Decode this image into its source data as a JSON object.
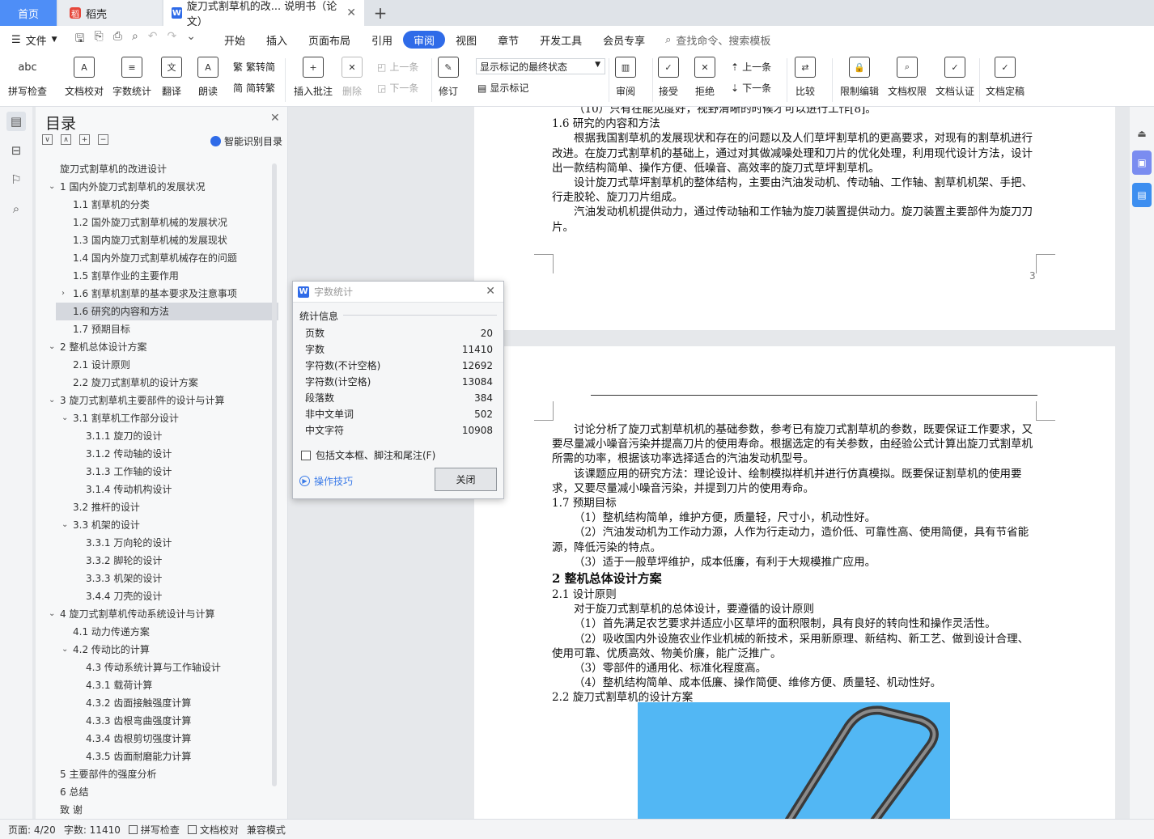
{
  "tabs": {
    "home": "首页",
    "daoke": "稻壳",
    "doc": "旋刀式割草机的改... 说明书（论文）",
    "new": "+"
  },
  "menu": {
    "file": "文件",
    "tabs": [
      "开始",
      "插入",
      "页面布局",
      "引用",
      "审阅",
      "视图",
      "章节",
      "开发工具",
      "会员专享"
    ],
    "active_tab": "审阅",
    "search": "查找命令、搜索模板"
  },
  "ribbon": {
    "spell": "拼写检查",
    "proof": "文档校对",
    "count": "字数统计",
    "translate": "翻译",
    "read": "朗读",
    "trad": "繁转简",
    "simp": "简转繁",
    "insert_comment": "插入批注",
    "delete": "删除",
    "prev_comment": "上一条",
    "next_comment": "下一条",
    "revise": "修订",
    "markup_state": "显示标记的最终状态",
    "show_markup": "显示标记",
    "review": "审阅",
    "accept": "接受",
    "reject": "拒绝",
    "prev": "上一条",
    "next": "下一条",
    "compare": "比较",
    "restrict": "限制编辑",
    "doc_rights": "文档权限",
    "doc_auth": "文档认证",
    "finalize": "文档定稿"
  },
  "toc": {
    "title": "目录",
    "smart": "智能识别目录",
    "items": [
      {
        "label": "旋刀式割草机的改进设计",
        "level": 0,
        "toggle": ""
      },
      {
        "label": "1 国内外旋刀式割草机的发展状况",
        "level": 0,
        "toggle": "v"
      },
      {
        "label": "1.1 割草机的分类",
        "level": 1,
        "toggle": ""
      },
      {
        "label": "1.2 国外旋刀式割草机械的发展状况",
        "level": 1,
        "toggle": ""
      },
      {
        "label": "1.3 国内旋刀式割草机械的发展现状",
        "level": 1,
        "toggle": ""
      },
      {
        "label": "1.4 国内外旋刀式割草机械存在的问题",
        "level": 1,
        "toggle": ""
      },
      {
        "label": "1.5 割草作业的主要作用",
        "level": 1,
        "toggle": ""
      },
      {
        "label": "1.6 割草机割草的基本要求及注意事项",
        "level": 1,
        "toggle": ">"
      },
      {
        "label": "1.6 研究的内容和方法",
        "level": 1,
        "toggle": "",
        "selected": true
      },
      {
        "label": "1.7 预期目标",
        "level": 1,
        "toggle": ""
      },
      {
        "label": "2 整机总体设计方案",
        "level": 0,
        "toggle": "v"
      },
      {
        "label": "2.1 设计原则",
        "level": 1,
        "toggle": ""
      },
      {
        "label": "2.2 旋刀式割草机的设计方案",
        "level": 1,
        "toggle": ""
      },
      {
        "label": "3 旋刀式割草机主要部件的设计与计算",
        "level": 0,
        "toggle": "v"
      },
      {
        "label": "3.1 割草机工作部分设计",
        "level": 1,
        "toggle": "v"
      },
      {
        "label": "3.1.1 旋刀的设计",
        "level": 2,
        "toggle": ""
      },
      {
        "label": "3.1.2 传动轴的设计",
        "level": 2,
        "toggle": ""
      },
      {
        "label": "3.1.3 工作轴的设计",
        "level": 2,
        "toggle": ""
      },
      {
        "label": "3.1.4 传动机构设计",
        "level": 2,
        "toggle": ""
      },
      {
        "label": "3.2 推杆的设计",
        "level": 1,
        "toggle": ""
      },
      {
        "label": "3.3 机架的设计",
        "level": 1,
        "toggle": "v"
      },
      {
        "label": "3.3.1 万向轮的设计",
        "level": 2,
        "toggle": ""
      },
      {
        "label": "3.3.2 脚轮的设计",
        "level": 2,
        "toggle": ""
      },
      {
        "label": "3.3.3 机架的设计",
        "level": 2,
        "toggle": ""
      },
      {
        "label": "3.4.4 刀壳的设计",
        "level": 2,
        "toggle": ""
      },
      {
        "label": "4 旋刀式割草机传动系统设计与计算",
        "level": 0,
        "toggle": "v"
      },
      {
        "label": "4.1 动力传递方案",
        "level": 1,
        "toggle": ""
      },
      {
        "label": "4.2 传动比的计算",
        "level": 1,
        "toggle": "v"
      },
      {
        "label": "4.3 传动系统计算与工作轴设计",
        "level": 2,
        "toggle": ""
      },
      {
        "label": "4.3.1 载荷计算",
        "level": 2,
        "toggle": ""
      },
      {
        "label": "4.3.2 齿面接触强度计算",
        "level": 2,
        "toggle": ""
      },
      {
        "label": "4.3.3 齿根弯曲强度计算",
        "level": 2,
        "toggle": ""
      },
      {
        "label": "4.3.4 齿根剪切强度计算",
        "level": 2,
        "toggle": ""
      },
      {
        "label": "4.3.5 齿面耐磨能力计算",
        "level": 2,
        "toggle": ""
      },
      {
        "label": "5 主要部件的强度分析",
        "level": 0,
        "toggle": ""
      },
      {
        "label": "6 总结",
        "level": 0,
        "toggle": ""
      },
      {
        "label": "致 谢",
        "level": 0,
        "toggle": ""
      }
    ]
  },
  "doc": {
    "page1": {
      "lines": [
        {
          "text": "（10）只有在能见度好，视野清晰的时候才可以进行工作[8]。",
          "cls": "ind"
        },
        {
          "text": "1.6 研究的内容和方法",
          "cls": ""
        },
        {
          "text": "根据我国割草机的发展现状和存在的问题以及人们草坪割草机的更高要求，对现有的割草机进行改进。在旋刀式割草机的基础上，通过对其做减噪处理和刀片的优化处理，利用现代设计方法，设计出一款结构简单、操作方便、低噪音、高效率的旋刀式草坪割草机。",
          "cls": "ind"
        },
        {
          "text": "设计旋刀式草坪割草机的整体结构，主要由汽油发动机、传动轴、工作轴、割草机机架、手把、行走胶轮、旋刀刀片组成。",
          "cls": "ind"
        },
        {
          "text": "汽油发动机机提供动力，通过传动轴和工作轴为旋刀装置提供动力。旋刀装置主要部件为旋刀刀片。",
          "cls": "ind"
        }
      ],
      "page_number": "3"
    },
    "page2": {
      "lines": [
        {
          "text": "讨论分析了旋刀式割草机机的基础参数，参考已有旋刀式割草机的参数，既要保证工作要求，又要尽量减小噪音污染并提高刀片的使用寿命。根据选定的有关参数，由经验公式计算出旋刀式割草机所需的功率，根据该功率选择适合的汽油发动机型号。",
          "cls": "ind"
        },
        {
          "text": "该课题应用的研究方法：理论设计、绘制模拟样机并进行仿真模拟。既要保证割草机的使用要求，又要尽量减小噪音污染，并提到刀片的使用寿命。",
          "cls": "ind"
        },
        {
          "text": "1.7 预期目标",
          "cls": ""
        },
        {
          "text": "（1）整机结构简单，维护方便，质量轻，尺寸小，机动性好。",
          "cls": "ind"
        },
        {
          "text": "（2）汽油发动机为工作动力源，人作为行走动力，造价低、可靠性高、使用简便，具有节省能源，降低污染的特点。",
          "cls": "ind"
        },
        {
          "text": "（3）适于一般草坪维护，成本低廉，有利于大规模推广应用。",
          "cls": "ind"
        },
        {
          "text": "2 整机总体设计方案",
          "cls": "h2"
        },
        {
          "text": "2.1 设计原则",
          "cls": ""
        },
        {
          "text": "对于旋刀式割草机的总体设计，要遵循的设计原则",
          "cls": "ind"
        },
        {
          "text": "（1）首先满足农艺要求并适应小区草坪的面积限制，具有良好的转向性和操作灵活性。",
          "cls": "ind"
        },
        {
          "text": "（2）吸收国内外设施农业作业机械的新技术，采用新原理、新结构、新工艺、做到设计合理、使用可靠、优质高效、物美价廉，能广泛推广。",
          "cls": "ind"
        },
        {
          "text": "（3）零部件的通用化、标准化程度高。",
          "cls": "ind"
        },
        {
          "text": "（4）整机结构简单、成本低廉、操作简便、维修方便、质量轻、机动性好。",
          "cls": "ind"
        },
        {
          "text": "2.2 旋刀式割草机的设计方案",
          "cls": ""
        }
      ]
    }
  },
  "dialog": {
    "title": "字数统计",
    "section": "统计信息",
    "stats": [
      {
        "label": "页数",
        "value": "20"
      },
      {
        "label": "字数",
        "value": "11410"
      },
      {
        "label": "字符数(不计空格)",
        "value": "12692"
      },
      {
        "label": "字符数(计空格)",
        "value": "13084"
      },
      {
        "label": "段落数",
        "value": "384"
      },
      {
        "label": "非中文单词",
        "value": "502"
      },
      {
        "label": "中文字符",
        "value": "10908"
      }
    ],
    "include_label": "包括文本框、脚注和尾注(F)",
    "tips": "操作技巧",
    "close": "关闭"
  },
  "status": {
    "page": "页面: 4/20",
    "words": "字数: 11410",
    "spell": "拼写检查",
    "proof": "文档校对",
    "compat": "兼容模式"
  },
  "colors": {
    "accent": "#2f6be8",
    "image_bg": "#52b7f4"
  }
}
